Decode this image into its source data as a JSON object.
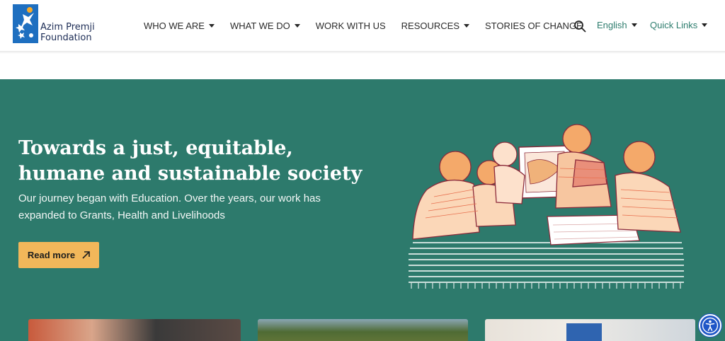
{
  "brand": {
    "line1": "Azim Premji",
    "line2": "Foundation",
    "logo_color": "#1e6fc0"
  },
  "nav": {
    "items": [
      {
        "label": "WHO WE ARE",
        "has_dropdown": true
      },
      {
        "label": "WHAT WE DO",
        "has_dropdown": true
      },
      {
        "label": "WORK WITH US",
        "has_dropdown": false
      },
      {
        "label": "RESOURCES",
        "has_dropdown": true
      },
      {
        "label": "STORIES OF CHANGE",
        "has_dropdown": false
      }
    ],
    "search_icon": "search-icon",
    "language": "English",
    "quick_links": "Quick Links"
  },
  "hero": {
    "title_line1": "Towards a just, equitable,",
    "title_line2": "humane and sustainable society",
    "subtitle": "Our journey began with Education. Over the years, our work has expanded to Grants, Health and Livelihoods",
    "cta_label": "Read more",
    "cta_icon": "arrow-up-right-icon",
    "bg_color": "#2d7a6c",
    "cta_color": "#f2b75a"
  },
  "accessibility": {
    "icon": "accessibility-icon",
    "color": "#1f56c7"
  }
}
